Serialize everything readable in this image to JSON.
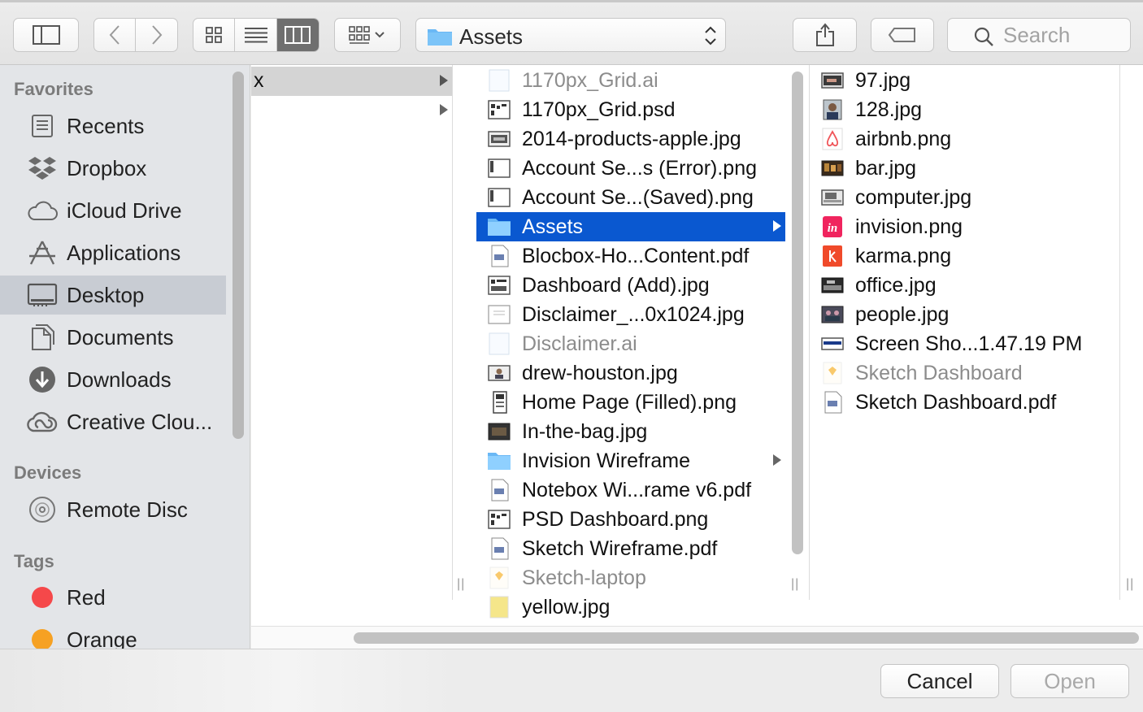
{
  "toolbar": {
    "path_label": "Assets",
    "search_placeholder": "Search"
  },
  "sidebar": {
    "favorites_heading": "Favorites",
    "favorites": [
      {
        "label": "Recents",
        "icon": "recents-icon"
      },
      {
        "label": "Dropbox",
        "icon": "dropbox-icon"
      },
      {
        "label": "iCloud Drive",
        "icon": "icloud-icon"
      },
      {
        "label": "Applications",
        "icon": "applications-icon"
      },
      {
        "label": "Desktop",
        "icon": "desktop-icon",
        "selected": true
      },
      {
        "label": "Documents",
        "icon": "documents-icon"
      },
      {
        "label": "Downloads",
        "icon": "downloads-icon"
      },
      {
        "label": "Creative Clou...",
        "icon": "creative-cloud-icon"
      }
    ],
    "devices_heading": "Devices",
    "devices": [
      {
        "label": "Remote Disc",
        "icon": "disc-icon"
      }
    ],
    "tags_heading": "Tags",
    "tags": [
      {
        "label": "Red",
        "color": "#f5484a"
      },
      {
        "label": "Orange",
        "color": "#f6a123"
      }
    ]
  },
  "column1": {
    "items": [
      {
        "label": "x",
        "has_children": true,
        "highlighted": true
      },
      {
        "label": "",
        "has_children": true
      }
    ]
  },
  "column2": {
    "items": [
      {
        "label": "1170px_Grid.ai",
        "dim": true
      },
      {
        "label": "1170px_Grid.psd"
      },
      {
        "label": "2014-products-apple.jpg"
      },
      {
        "label": "Account Se...s (Error).png"
      },
      {
        "label": "Account Se...(Saved).png"
      },
      {
        "label": "Assets",
        "folder": true,
        "selected": true
      },
      {
        "label": "Blocbox-Ho...Content.pdf"
      },
      {
        "label": "Dashboard (Add).jpg"
      },
      {
        "label": "Disclaimer_...0x1024.jpg"
      },
      {
        "label": "Disclaimer.ai",
        "dim": true
      },
      {
        "label": "drew-houston.jpg"
      },
      {
        "label": "Home Page (Filled).png"
      },
      {
        "label": "In-the-bag.jpg"
      },
      {
        "label": "Invision Wireframe",
        "folder": true
      },
      {
        "label": "Notebox Wi...rame v6.pdf"
      },
      {
        "label": "PSD Dashboard.png"
      },
      {
        "label": "Sketch Wireframe.pdf"
      },
      {
        "label": "Sketch-laptop",
        "dim": true
      },
      {
        "label": "yellow.jpg"
      }
    ]
  },
  "column3": {
    "items": [
      {
        "label": "97.jpg"
      },
      {
        "label": "128.jpg"
      },
      {
        "label": "airbnb.png"
      },
      {
        "label": "bar.jpg"
      },
      {
        "label": "computer.jpg"
      },
      {
        "label": "invision.png"
      },
      {
        "label": "karma.png"
      },
      {
        "label": "office.jpg"
      },
      {
        "label": "people.jpg"
      },
      {
        "label": "Screen Sho...1.47.19 PM"
      },
      {
        "label": "Sketch Dashboard",
        "dim": true
      },
      {
        "label": "Sketch Dashboard.pdf"
      }
    ]
  },
  "buttons": {
    "cancel": "Cancel",
    "open": "Open"
  },
  "colors": {
    "selection": "#0a58d0",
    "sidebar_selection": "#c8ccd3"
  }
}
